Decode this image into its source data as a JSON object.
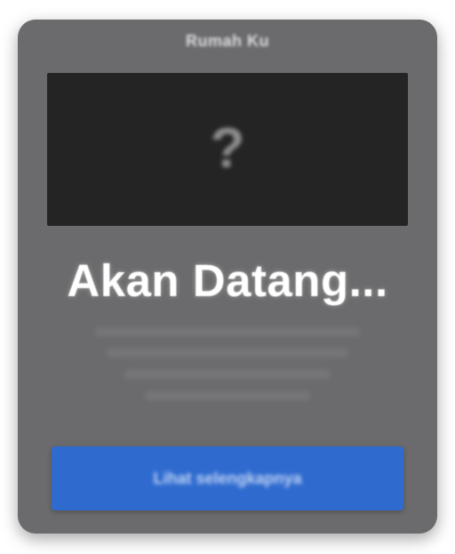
{
  "card": {
    "title": "Rumah Ku",
    "preview_icon": "question-icon",
    "preview_glyph": "?",
    "overlay_text": "Akan Datang...",
    "button_label": "Lihat selengkapnya"
  },
  "colors": {
    "card_bg": "#6b6b6d",
    "preview_bg": "#242424",
    "button_bg": "#2f6bcf",
    "overlay_text": "#ffffff"
  }
}
